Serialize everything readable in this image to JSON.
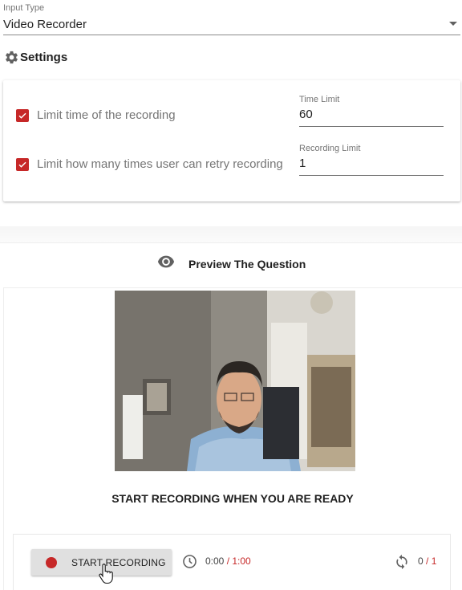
{
  "input_type": {
    "label": "Input Type",
    "value": "Video Recorder"
  },
  "settings": {
    "title": "Settings",
    "options": [
      {
        "label": "Limit time of the recording",
        "checked": true,
        "field_label": "Time Limit",
        "field_value": "60"
      },
      {
        "label": "Limit how many times user can retry recording",
        "checked": true,
        "field_label": "Recording Limit",
        "field_value": "1"
      }
    ]
  },
  "preview": {
    "title": "Preview The Question",
    "prompt": "START RECORDING WHEN YOU ARE READY"
  },
  "recorder": {
    "button_label": "START RECORDING",
    "elapsed": "0:00",
    "time_limit": " / 1:00",
    "retries_used": "0",
    "retry_limit": " / 1"
  },
  "colors": {
    "accent": "#c62828",
    "text": "#212121",
    "muted": "#757575"
  }
}
